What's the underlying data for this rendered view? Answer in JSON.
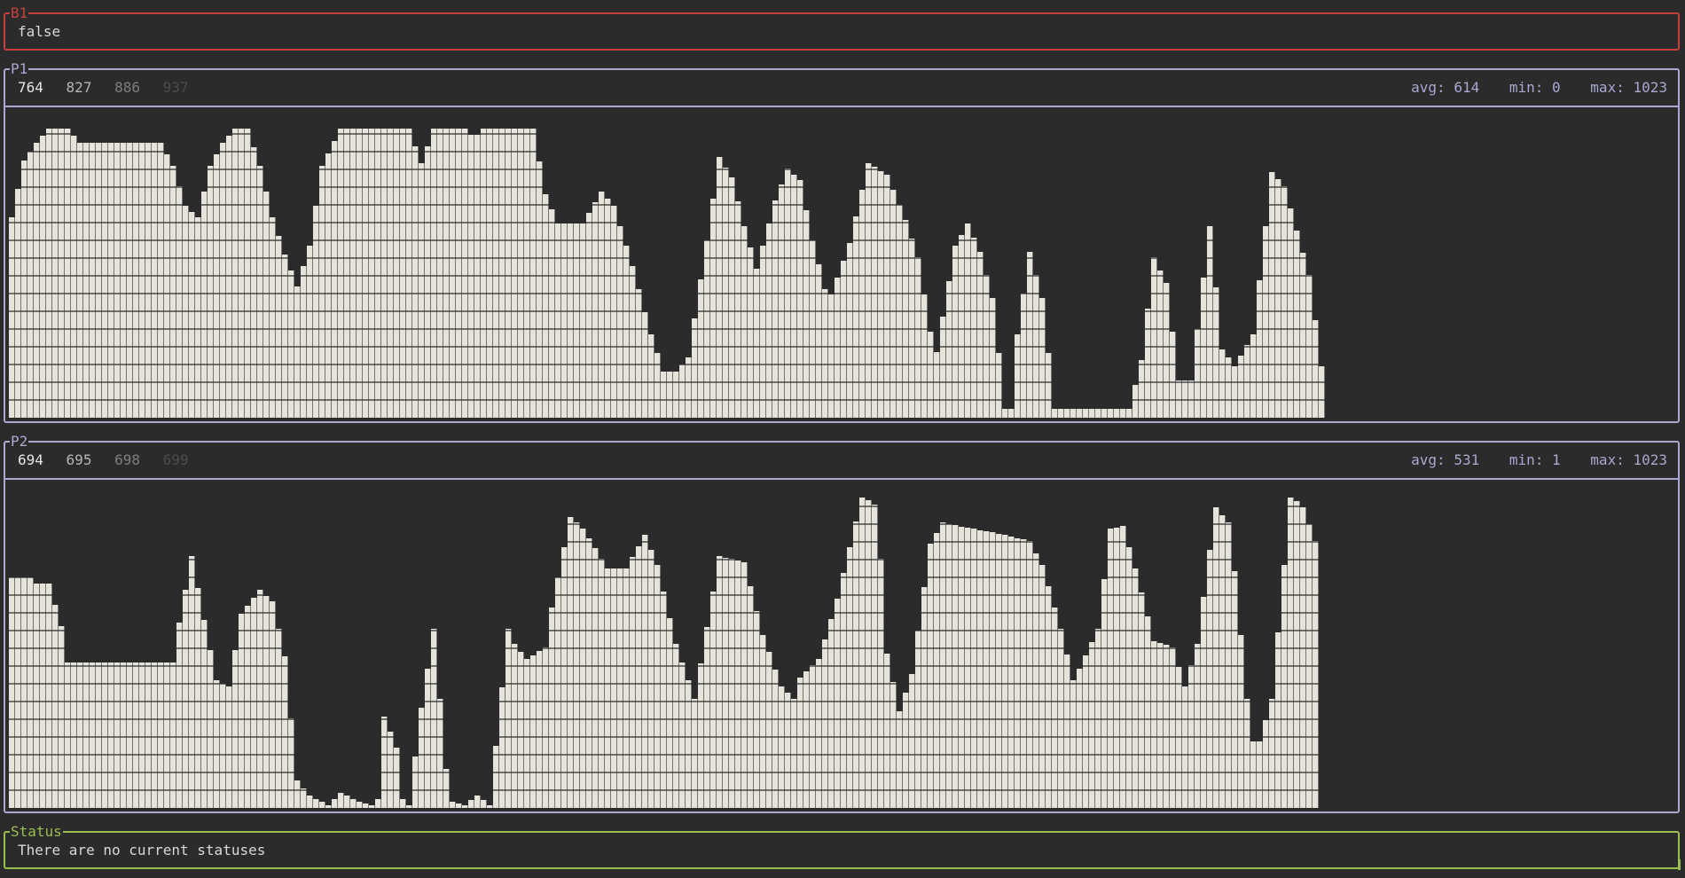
{
  "b1": {
    "title": "B1",
    "value": "false"
  },
  "p1": {
    "title": "P1",
    "recent": [
      "764",
      "827",
      "886",
      "937"
    ],
    "avg": "avg: 614",
    "min": "min: 0",
    "max": "max: 1023",
    "fill_color": "#e6e4da",
    "line_color": "#2b2b2b",
    "chart_data": {
      "type": "area",
      "ylim": [
        0,
        1023
      ],
      "keypoints": [
        [
          0,
          700
        ],
        [
          2,
          900
        ],
        [
          4,
          960
        ],
        [
          6,
          1010
        ],
        [
          9,
          1010
        ],
        [
          11,
          960
        ],
        [
          24,
          960
        ],
        [
          26,
          880
        ],
        [
          28,
          740
        ],
        [
          30,
          700
        ],
        [
          32,
          880
        ],
        [
          34,
          960
        ],
        [
          36,
          1010
        ],
        [
          38,
          1010
        ],
        [
          40,
          880
        ],
        [
          42,
          700
        ],
        [
          44,
          570
        ],
        [
          46,
          460
        ],
        [
          48,
          600
        ],
        [
          50,
          880
        ],
        [
          53,
          1010
        ],
        [
          64,
          1010
        ],
        [
          66,
          890
        ],
        [
          68,
          1010
        ],
        [
          73,
          1010
        ],
        [
          74,
          990
        ],
        [
          75,
          990
        ],
        [
          76,
          1010
        ],
        [
          84,
          1010
        ],
        [
          86,
          780
        ],
        [
          88,
          680
        ],
        [
          92,
          680
        ],
        [
          95,
          790
        ],
        [
          97,
          740
        ],
        [
          100,
          530
        ],
        [
          103,
          290
        ],
        [
          105,
          160
        ],
        [
          107,
          160
        ],
        [
          109,
          210
        ],
        [
          112,
          620
        ],
        [
          114,
          910
        ],
        [
          116,
          840
        ],
        [
          118,
          670
        ],
        [
          120,
          520
        ],
        [
          123,
          760
        ],
        [
          125,
          870
        ],
        [
          127,
          830
        ],
        [
          129,
          620
        ],
        [
          131,
          450
        ],
        [
          132,
          430
        ],
        [
          135,
          610
        ],
        [
          138,
          890
        ],
        [
          141,
          850
        ],
        [
          144,
          690
        ],
        [
          146,
          560
        ],
        [
          148,
          300
        ],
        [
          149,
          230
        ],
        [
          152,
          600
        ],
        [
          154,
          680
        ],
        [
          156,
          580
        ],
        [
          158,
          420
        ],
        [
          160,
          30
        ],
        [
          161,
          30
        ],
        [
          162,
          290
        ],
        [
          164,
          580
        ],
        [
          166,
          420
        ],
        [
          168,
          30
        ],
        [
          180,
          30
        ],
        [
          182,
          200
        ],
        [
          184,
          560
        ],
        [
          186,
          470
        ],
        [
          188,
          130
        ],
        [
          190,
          130
        ],
        [
          193,
          670
        ],
        [
          195,
          240
        ],
        [
          197,
          180
        ],
        [
          200,
          290
        ],
        [
          203,
          860
        ],
        [
          205,
          810
        ],
        [
          209,
          500
        ],
        [
          211,
          180
        ]
      ]
    }
  },
  "p2": {
    "title": "P2",
    "recent": [
      "694",
      "695",
      "698",
      "699"
    ],
    "avg": "avg: 531",
    "min": "min: 1",
    "max": "max: 1023",
    "fill_color": "#e6e4da",
    "line_color": "#2b2b2b",
    "chart_data": {
      "type": "area",
      "ylim": [
        0,
        1023
      ],
      "keypoints": [
        [
          0,
          760
        ],
        [
          3,
          760
        ],
        [
          4,
          740
        ],
        [
          6,
          740
        ],
        [
          8,
          600
        ],
        [
          9,
          480
        ],
        [
          26,
          480
        ],
        [
          27,
          610
        ],
        [
          29,
          830
        ],
        [
          31,
          620
        ],
        [
          33,
          420
        ],
        [
          35,
          400
        ],
        [
          37,
          640
        ],
        [
          40,
          720
        ],
        [
          42,
          680
        ],
        [
          44,
          500
        ],
        [
          46,
          90
        ],
        [
          48,
          40
        ],
        [
          51,
          10
        ],
        [
          53,
          50
        ],
        [
          56,
          20
        ],
        [
          58,
          10
        ],
        [
          59,
          30
        ],
        [
          60,
          300
        ],
        [
          62,
          200
        ],
        [
          63,
          30
        ],
        [
          64,
          10
        ],
        [
          66,
          330
        ],
        [
          68,
          590
        ],
        [
          70,
          130
        ],
        [
          71,
          20
        ],
        [
          73,
          10
        ],
        [
          75,
          40
        ],
        [
          77,
          10
        ],
        [
          80,
          590
        ],
        [
          81,
          540
        ],
        [
          83,
          490
        ],
        [
          86,
          530
        ],
        [
          87,
          660
        ],
        [
          90,
          960
        ],
        [
          92,
          920
        ],
        [
          96,
          790
        ],
        [
          99,
          790
        ],
        [
          102,
          900
        ],
        [
          104,
          800
        ],
        [
          107,
          540
        ],
        [
          110,
          360
        ],
        [
          114,
          830
        ],
        [
          118,
          810
        ],
        [
          121,
          570
        ],
        [
          124,
          400
        ],
        [
          126,
          360
        ],
        [
          127,
          430
        ],
        [
          130,
          490
        ],
        [
          133,
          690
        ],
        [
          135,
          860
        ],
        [
          137,
          1030
        ],
        [
          139,
          1000
        ],
        [
          140,
          820
        ],
        [
          141,
          510
        ],
        [
          143,
          320
        ],
        [
          145,
          440
        ],
        [
          148,
          870
        ],
        [
          150,
          940
        ],
        [
          155,
          920
        ],
        [
          160,
          900
        ],
        [
          164,
          880
        ],
        [
          166,
          800
        ],
        [
          169,
          590
        ],
        [
          171,
          420
        ],
        [
          172,
          460
        ],
        [
          175,
          590
        ],
        [
          177,
          920
        ],
        [
          179,
          930
        ],
        [
          181,
          790
        ],
        [
          184,
          550
        ],
        [
          187,
          530
        ],
        [
          189,
          400
        ],
        [
          191,
          540
        ],
        [
          193,
          850
        ],
        [
          194,
          990
        ],
        [
          196,
          940
        ],
        [
          197,
          780
        ],
        [
          199,
          360
        ],
        [
          200,
          220
        ],
        [
          201,
          220
        ],
        [
          203,
          360
        ],
        [
          205,
          800
        ],
        [
          206,
          1030
        ],
        [
          208,
          990
        ],
        [
          210,
          880
        ]
      ]
    }
  },
  "status": {
    "title": "Status",
    "message": "There are no current statuses"
  }
}
